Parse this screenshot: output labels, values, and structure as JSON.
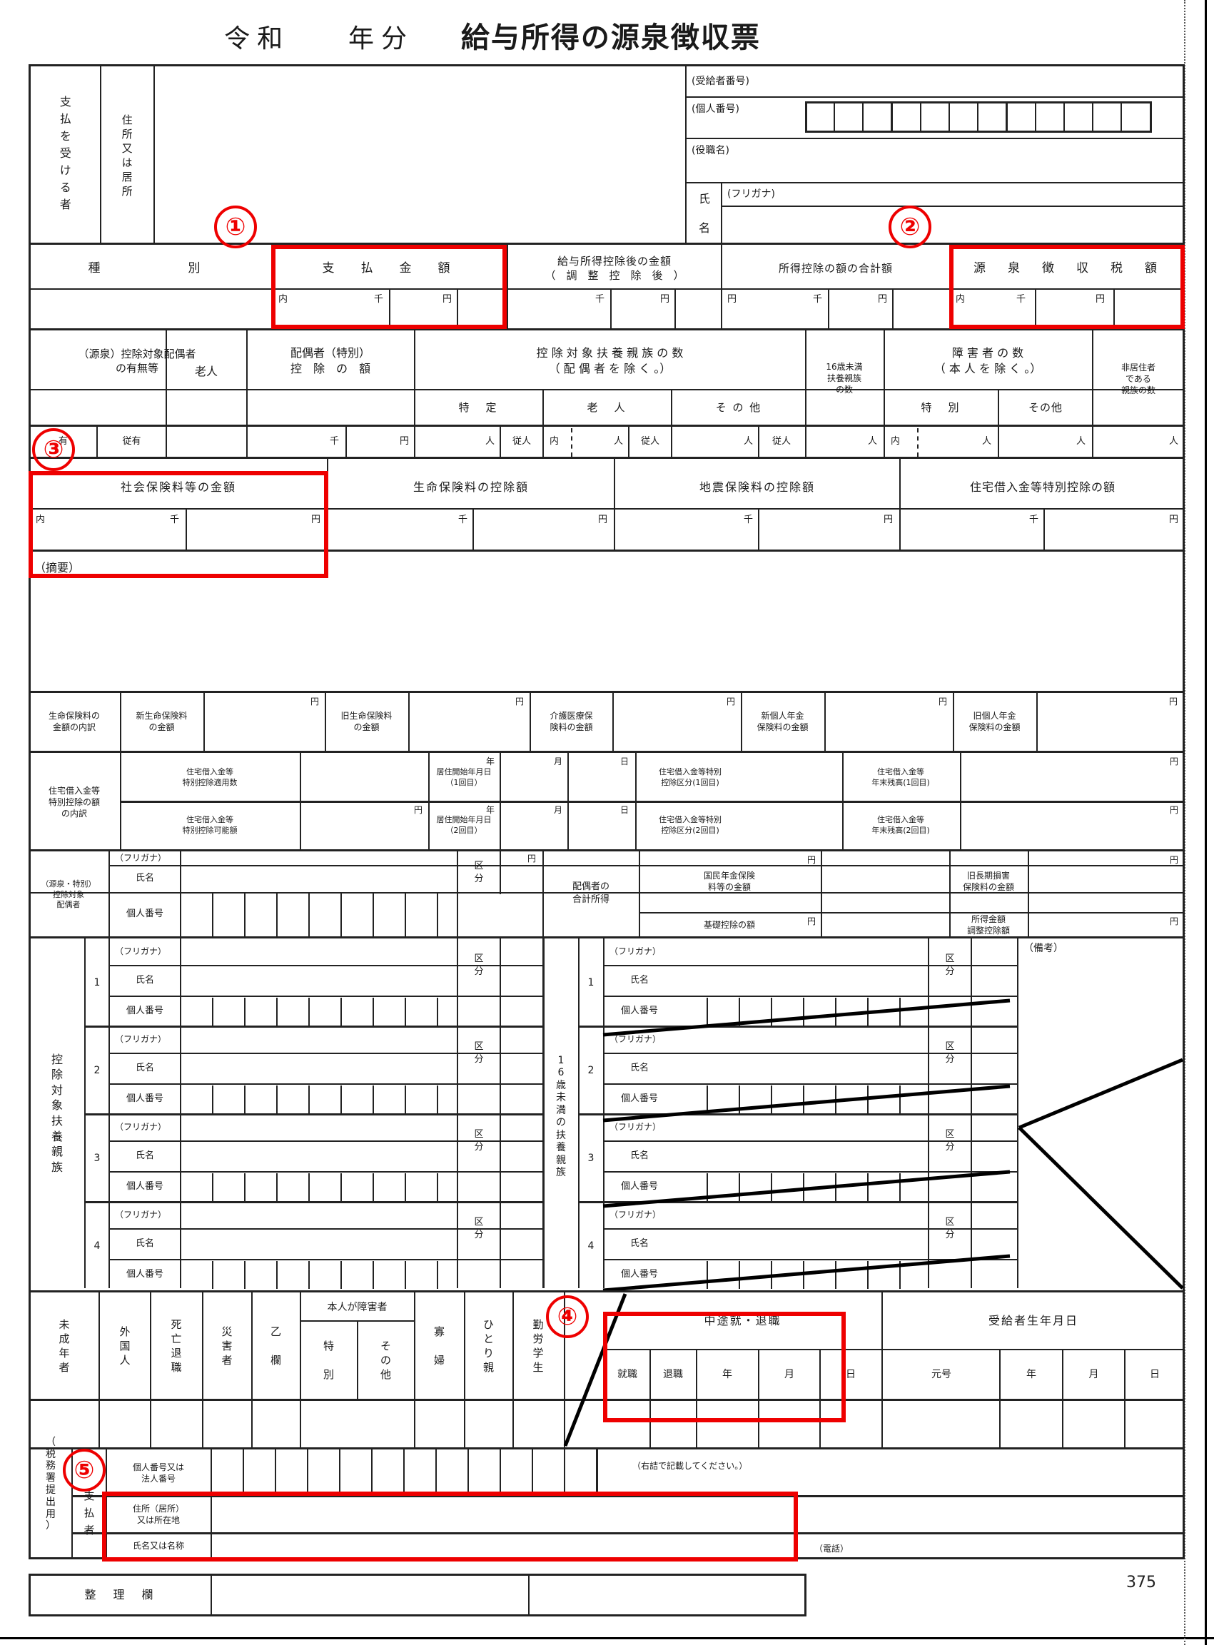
{
  "document": {
    "title_era": "令和",
    "title_year_suffix": "年分",
    "title_main": "給与所得の源泉徴収票",
    "page_number": "375"
  },
  "recipient": {
    "label_payee": "支払を受ける者",
    "label_address": "住所又は居所",
    "label_receipt_number": "(受給者番号)",
    "label_personal_number": "(個人番号)",
    "label_job_title": "(役職名)",
    "label_name": "氏名",
    "label_furigana": "(フリガナ)",
    "personal_number_cells": 12
  },
  "amounts_row": {
    "type_label": "種　　　別",
    "payment_amount": "支　払　金　額",
    "after_deduction": "給与所得控除後の金額",
    "after_deduction_sub": "（　調　整　控　除　後　）",
    "total_deductions": "所得控除の額の合計額",
    "withholding_tax": "源　泉　徴　収　税　額",
    "marker_inner": "内",
    "marker_thousand": "千",
    "marker_yen": "円"
  },
  "spouse_dependents": {
    "spouse_exists": "（源泉）控除対象配偶者",
    "spouse_exists_sub": "の有無等",
    "elderly": "老人",
    "spouse_special_deduction": "配偶者（特別）",
    "spouse_special_deduction_sub": "控　除　の　額",
    "dependents_count": "控 除 対 象 扶 養 親 族 の 数",
    "dependents_count_sub": "（ 配 偶 者 を 除 く 。）",
    "specific": "特　定",
    "old": "老　人",
    "other": "そ の 他",
    "under16": "16歳未満\n扶養親族\nの数",
    "disabled_count": "障 害 者 の 数",
    "disabled_count_sub": "（ 本 人 を 除 く 。）",
    "special": "特　別",
    "disabled_other": "その他",
    "nonresident": "非居住者\nである\n親族の数",
    "yes": "有",
    "follow_yes": "従有",
    "unit_person": "人",
    "unit_follow_person": "従人",
    "marker_inner": "内",
    "marker_thousand": "千",
    "marker_yen": "円"
  },
  "insurance_row": {
    "social_insurance": "社会保険料等の金額",
    "life_insurance": "生命保険料の控除額",
    "earthquake_insurance": "地震保険料の控除額",
    "housing_loan": "住宅借入金等特別控除の額",
    "marker_inner": "内",
    "marker_thousand": "千",
    "marker_yen": "円"
  },
  "summary": {
    "label": "（摘要）"
  },
  "life_breakdown": {
    "row_label": "生命保険料の\n金額の内訳",
    "new_life": "新生命保険料\nの金額",
    "old_life": "旧生命保険料\nの金額",
    "care_medical": "介護医療保\n険料の金額",
    "new_pension": "新個人年金\n保険料の金額",
    "old_pension": "旧個人年金\n保険料の金額",
    "yen": "円"
  },
  "housing_breakdown": {
    "row_label": "住宅借入金等\n特別控除の額\nの内訳",
    "applicable_count": "住宅借入金等\n特別控除適用数",
    "deductible_amount": "住宅借入金等\n特別控除可能額",
    "move_in_1": "居住開始年月日\n（1回目）",
    "move_in_2": "居住開始年月日\n（2回目）",
    "loan_class_1": "住宅借入金等特別\n控除区分(1回目)",
    "loan_class_2": "住宅借入金等特別\n控除区分(2回目)",
    "year_end_1": "住宅借入金等\n年末残高(1回目)",
    "year_end_2": "住宅借入金等\n年末残高(2回目)",
    "year": "年",
    "month": "月",
    "day": "日",
    "yen": "円"
  },
  "spouse_detail": {
    "row_label": "（源泉・特別）\n控除対象\n配偶者",
    "furigana": "（フリガナ）",
    "name": "氏名",
    "personal_number": "個人番号",
    "classification": "区\n分",
    "spouse_income": "配偶者の\n合計所得",
    "national_pension": "国民年金保険\n料等の金額",
    "old_long_term": "旧長期損害\n保険料の金額",
    "basic_deduction": "基礎控除の額",
    "income_adjust": "所得金額\n調整控除額",
    "yen": "円"
  },
  "dependents_table": {
    "left_label": "控\n除\n対\n象\n扶\n養\n親\n族",
    "right_label": "1\n6\n歳\n未\n満\n の \n扶\n養\n親\n族",
    "remarks": "（備考）",
    "furigana": "（フリガナ）",
    "name": "氏名",
    "personal_number": "個人番号",
    "classification": "区\n分",
    "rows": [
      "1",
      "2",
      "3",
      "4"
    ]
  },
  "status_row": {
    "items": [
      {
        "label": "未\n成\n年\n者"
      },
      {
        "label": "外\n国\n人"
      },
      {
        "label": "死\n亡\n退\n職"
      },
      {
        "label": "災\n害\n者"
      },
      {
        "label": "乙\n\n欄"
      },
      {
        "label": "寡\n\n婦"
      },
      {
        "label": "ひ\nと\nり\n親"
      },
      {
        "label": "勤\n労\n学\n生"
      }
    ],
    "self_disabled": "本人が障害者",
    "self_disabled_special": "特\n\n別",
    "self_disabled_other": "そ\nの\n他"
  },
  "retirement": {
    "title": "中途就・退職",
    "employed": "就職",
    "retired": "退職",
    "year": "年",
    "month": "月",
    "day": "日",
    "birth_title": "受給者生年月日",
    "era": "元号",
    "birth_year": "年",
    "birth_month": "月",
    "birth_day": "日"
  },
  "payer": {
    "side_label": "（\n税\n務\n署\n提\n出\n用\n）",
    "payer_label": "支\n払\n者",
    "number_label": "個人番号又は\n法人番号",
    "note": "（右詰で記載してください。）",
    "address_label": "住所（居所）\n又は所在地",
    "name_label": "氏名又は名称",
    "phone_label": "（電話）",
    "sort_column": "整　理　欄"
  },
  "annotations": {
    "markers": [
      "①",
      "②",
      "③",
      "④",
      "⑤"
    ],
    "marker_color": "#ee0000"
  }
}
